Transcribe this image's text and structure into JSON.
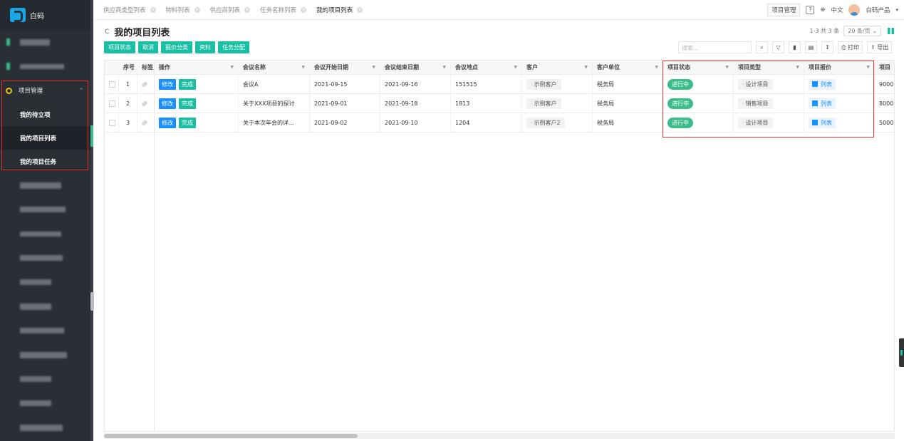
{
  "app": {
    "name": "白码"
  },
  "sidebar": {
    "group": {
      "label": "项目管理"
    },
    "sub_items": [
      {
        "label": "我的待立项",
        "active": false
      },
      {
        "label": "我的项目列表",
        "active": true
      },
      {
        "label": "我的项目任务",
        "active": false
      }
    ]
  },
  "tabs": [
    {
      "label": "供应商类型列表",
      "active": false
    },
    {
      "label": "物料列表",
      "active": false
    },
    {
      "label": "供应商列表",
      "active": false
    },
    {
      "label": "任务名称列表",
      "active": false
    },
    {
      "label": "我的项目列表",
      "active": true
    }
  ],
  "topbar": {
    "module": "项目管理",
    "language": "中文",
    "product": "白码产品"
  },
  "page": {
    "title": "我的项目列表",
    "pager_text": "1-3 共 3 条",
    "page_size": "20 条/页"
  },
  "actions": [
    "项目状态",
    "取消",
    "报价分类",
    "资料",
    "任务分配"
  ],
  "toolbar": {
    "search_placeholder": "搜索...",
    "print_label": "打印",
    "export_label": "导出"
  },
  "table": {
    "headers": {
      "index": "序号",
      "tag": "标签",
      "ops": "操作",
      "name": "会议名称",
      "start": "会议开始日期",
      "end": "会议结束日期",
      "place": "会议地点",
      "customer": "客户",
      "unit": "客户单位",
      "status": "项目状态",
      "type": "项目类型",
      "quote": "项目报价",
      "more": "项目"
    },
    "edit_label": "修改",
    "done_label": "完成",
    "rows": [
      {
        "index": "1",
        "name": "会议A",
        "start": "2021-09-15",
        "end": "2021-09-16",
        "place": "151515",
        "customer": "示例客户",
        "unit": "税务局",
        "status": "进行中",
        "type": "设计项目",
        "quote": "列表",
        "more": "9000"
      },
      {
        "index": "2",
        "name": "关于XXX项目的探讨",
        "start": "2021-09-01",
        "end": "2021-09-18",
        "place": "1813",
        "customer": "示例客户",
        "unit": "税务局",
        "status": "进行中",
        "type": "销售项目",
        "quote": "列表",
        "more": "8000"
      },
      {
        "index": "3",
        "name": "关于本次年会的详...",
        "start": "2021-09-02",
        "end": "2021-09-10",
        "place": "1204",
        "customer": "示例客户2",
        "unit": "税务局",
        "status": "进行中",
        "type": "设计项目",
        "quote": "列表",
        "more": "5000"
      }
    ]
  },
  "colors": {
    "sidebar_bg": "#2a2f36",
    "accent_teal": "#19bfa2",
    "status_green": "#3bbd8b",
    "edit_blue": "#1890ff",
    "highlight_red": "#e6332a"
  }
}
